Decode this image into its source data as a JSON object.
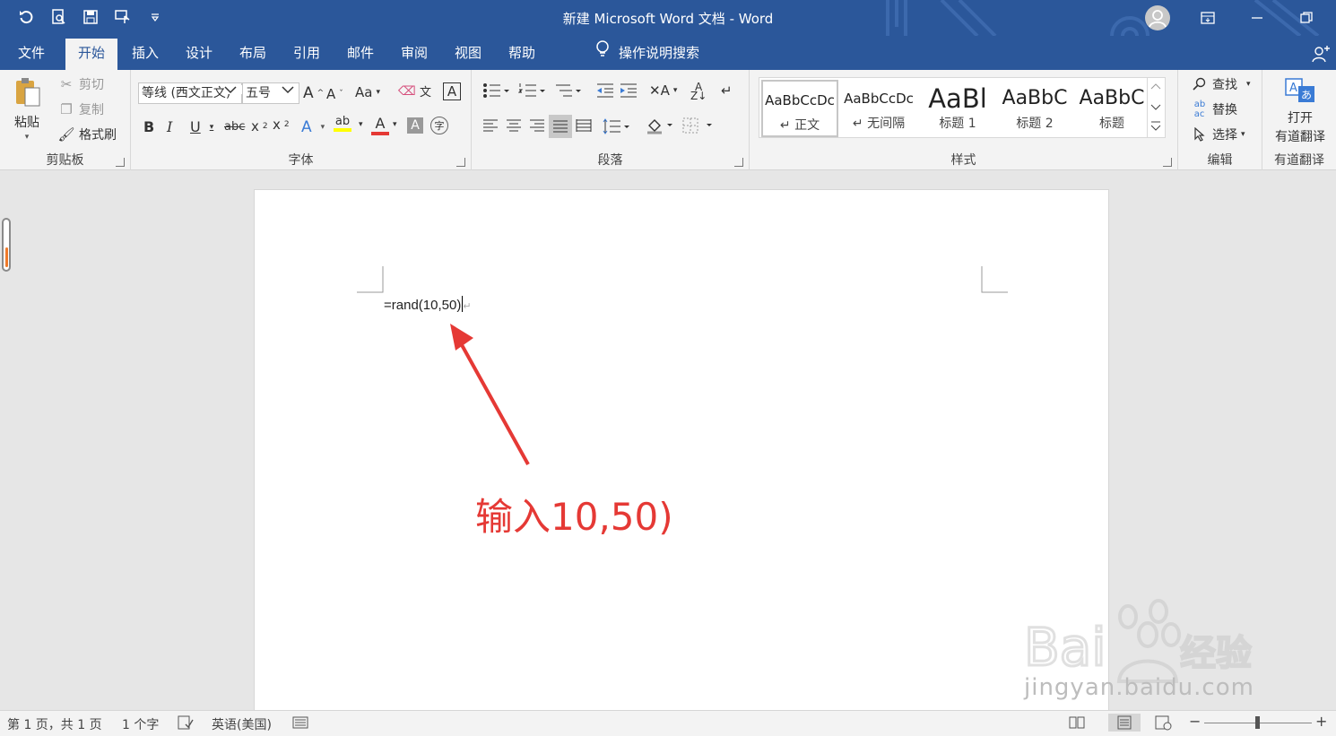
{
  "window": {
    "title": "新建 Microsoft Word 文档 - Word"
  },
  "quick_access": [
    "undo-icon",
    "print-preview-icon",
    "save-icon",
    "touch-mode-icon",
    "customize-qat-icon"
  ],
  "menu": {
    "tabs": [
      {
        "label": "文件"
      },
      {
        "label": "开始"
      },
      {
        "label": "插入"
      },
      {
        "label": "设计"
      },
      {
        "label": "布局"
      },
      {
        "label": "引用"
      },
      {
        "label": "邮件"
      },
      {
        "label": "审阅"
      },
      {
        "label": "视图"
      },
      {
        "label": "帮助"
      }
    ],
    "active_tab": "开始",
    "search_label": "操作说明搜索"
  },
  "ribbon": {
    "clipboard": {
      "label": "剪贴板",
      "paste": "粘贴",
      "cut": "剪切",
      "copy": "复制",
      "format_painter": "格式刷"
    },
    "font": {
      "label": "字体",
      "font_name": "等线 (西文正文)",
      "font_size": "五号"
    },
    "paragraph": {
      "label": "段落"
    },
    "styles": {
      "label": "样式",
      "items": [
        {
          "preview": "AaBbCcDc",
          "name": "↵ 正文"
        },
        {
          "preview": "AaBbCcDc",
          "name": "↵ 无间隔"
        },
        {
          "preview": "AaBl",
          "name": "标题 1"
        },
        {
          "preview": "AaBbC",
          "name": "标题 2"
        },
        {
          "preview": "AaBbC",
          "name": "标题"
        }
      ]
    },
    "editing": {
      "label": "编辑",
      "find": "查找",
      "replace": "替换",
      "select": "选择"
    },
    "youdao": {
      "label": "有道翻译",
      "button_line1": "打开",
      "button_line2": "有道翻译"
    }
  },
  "document": {
    "text": "=rand(10,50)",
    "annotation": "输入10,50)"
  },
  "watermark": {
    "text": "jingyan.baidu.com"
  },
  "statusbar": {
    "page": "第 1 页，共 1 页",
    "words": "1 个字",
    "language": "英语(美国)"
  },
  "colors": {
    "accent": "#2b579a",
    "annotation": "#e53935",
    "font_color_bar": "#e53935",
    "highlight_bar": "#ffff00"
  }
}
